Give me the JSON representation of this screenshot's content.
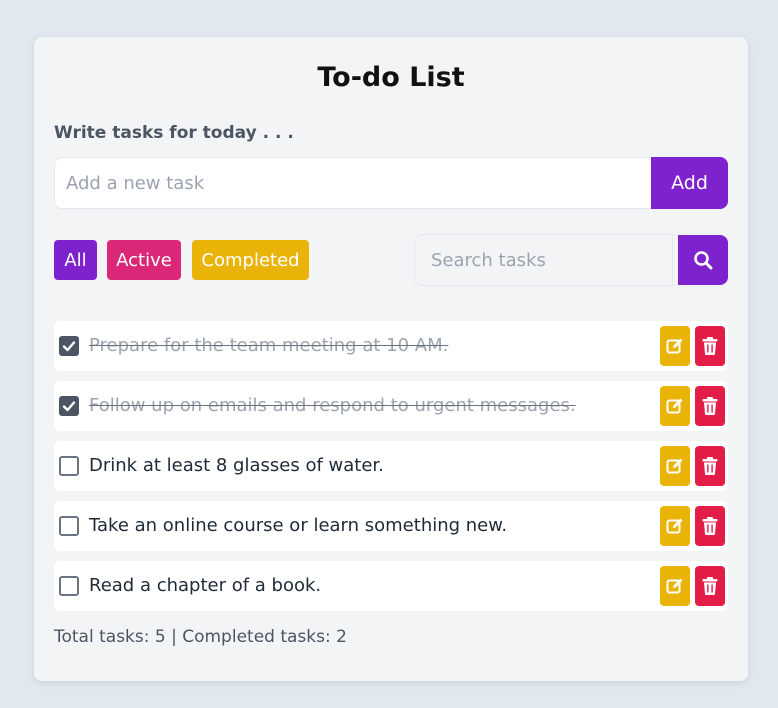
{
  "header": {
    "title": "To-do List",
    "subtitle": "Write tasks for today . . ."
  },
  "add_task": {
    "placeholder": "Add a new task",
    "value": "",
    "button_label": "Add"
  },
  "filters": [
    {
      "label": "All",
      "color": "#7e22ce"
    },
    {
      "label": "Active",
      "color": "#db2777"
    },
    {
      "label": "Completed",
      "color": "#eab308"
    }
  ],
  "search": {
    "placeholder": "Search tasks",
    "value": "",
    "icon": "search-icon"
  },
  "tasks": [
    {
      "text": "Prepare for the team meeting at 10 AM.",
      "completed": true
    },
    {
      "text": "Follow up on emails and respond to urgent messages.",
      "completed": true
    },
    {
      "text": "Drink at least 8 glasses of water.",
      "completed": false
    },
    {
      "text": "Take an online course or learn something new.",
      "completed": false
    },
    {
      "text": "Read a chapter of a book.",
      "completed": false
    }
  ],
  "task_actions": {
    "edit_icon": "edit-icon",
    "delete_icon": "trash-icon",
    "edit_color": "#eab308",
    "delete_color": "#e11d48"
  },
  "footer": {
    "summary": "Total tasks: 5 | Completed tasks: 2"
  },
  "colors": {
    "accent": "#7e22ce",
    "pink": "#db2777",
    "yellow": "#eab308",
    "red": "#e11d48"
  }
}
